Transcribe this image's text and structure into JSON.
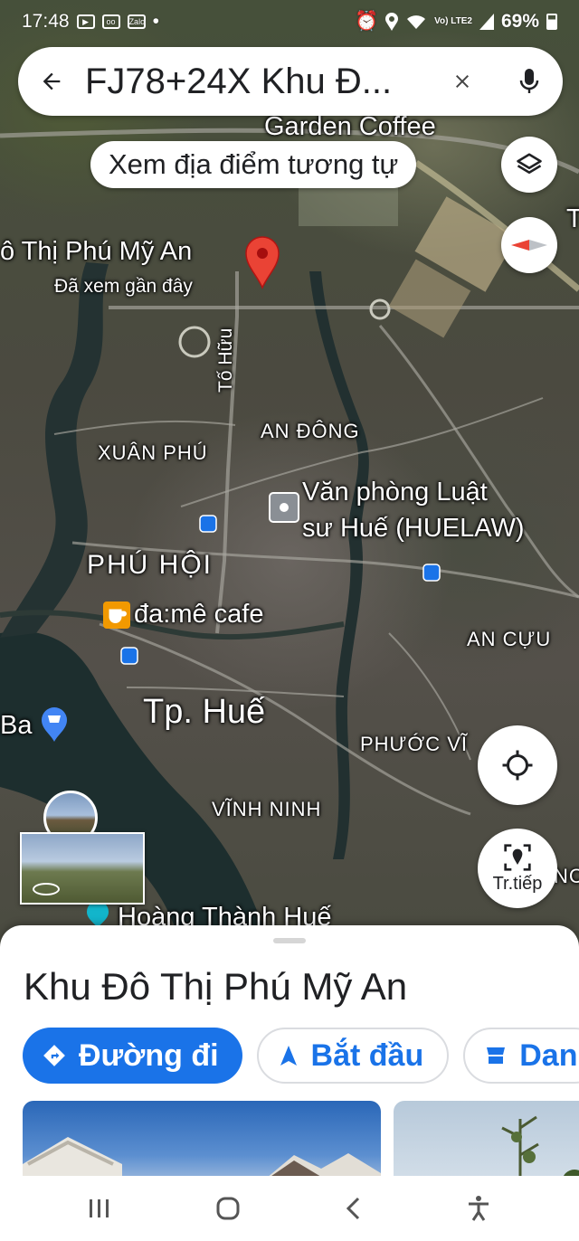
{
  "status_bar": {
    "time": "17:48",
    "left_icons": [
      "youtube-icon",
      "voicemail-icon",
      "zalo-icon",
      "dot-icon"
    ],
    "zalo_text": "Zalo",
    "network": "Vo) LTE2",
    "battery": "69%",
    "right_icons": [
      "alarm-icon",
      "location-icon",
      "wifi-icon",
      "signal-icon",
      "signal-icon",
      "battery-icon"
    ]
  },
  "search": {
    "query": "FJ78+24X Khu Đ...",
    "back_icon": "arrow-left-icon",
    "clear_icon": "close-icon",
    "mic_icon": "mic-icon"
  },
  "similar_chip": "Xem địa điểm tương tự",
  "map": {
    "labels": {
      "garden_coffee": "Garden Coffee",
      "place_name": "ô Thị Phú Mỹ An",
      "recently_viewed": "Đã xem gần đây",
      "to_huu": "Tố Hữu",
      "an_dong": "AN ĐÔNG",
      "xuan_phu": "XUÂN PHÚ",
      "law_office_1": "Văn phòng Luật",
      "law_office_2": "sư Huế (HUELAW)",
      "phu_hoi": "PHÚ HỘI",
      "cafe": "đa:mê cafe",
      "an_cuu": "AN CỰU",
      "city": "Tp. Huế",
      "ba": "Ba",
      "phuoc_vinh": "PHƯỚC VĨ",
      "vinh_ninh": "VĨNH NINH",
      "hoang_thanh": "Hoàng Thành Huế",
      "edge_t": "T",
      "edge_nc": "NC"
    },
    "pin_color": "#ea4335",
    "water_color": "#1d2e2e"
  },
  "controls": {
    "layers_icon": "layers-icon",
    "compass_icon": "compass-icon",
    "locate_icon": "my-location-icon",
    "live_label": "Tr.tiếp",
    "live_icon": "live-view-icon"
  },
  "sheet": {
    "title": "Khu Đô Thị Phú Mỹ An",
    "actions": [
      {
        "label": "Đường đi",
        "icon": "directions-icon"
      },
      {
        "label": "Bắt đầu",
        "icon": "navigation-icon"
      },
      {
        "label": "Dan",
        "icon": "save-icon"
      }
    ],
    "accent_color": "#1a73e8"
  },
  "nav_bar": {
    "icons": [
      "recent-apps-icon",
      "home-icon",
      "back-icon",
      "accessibility-icon"
    ]
  }
}
